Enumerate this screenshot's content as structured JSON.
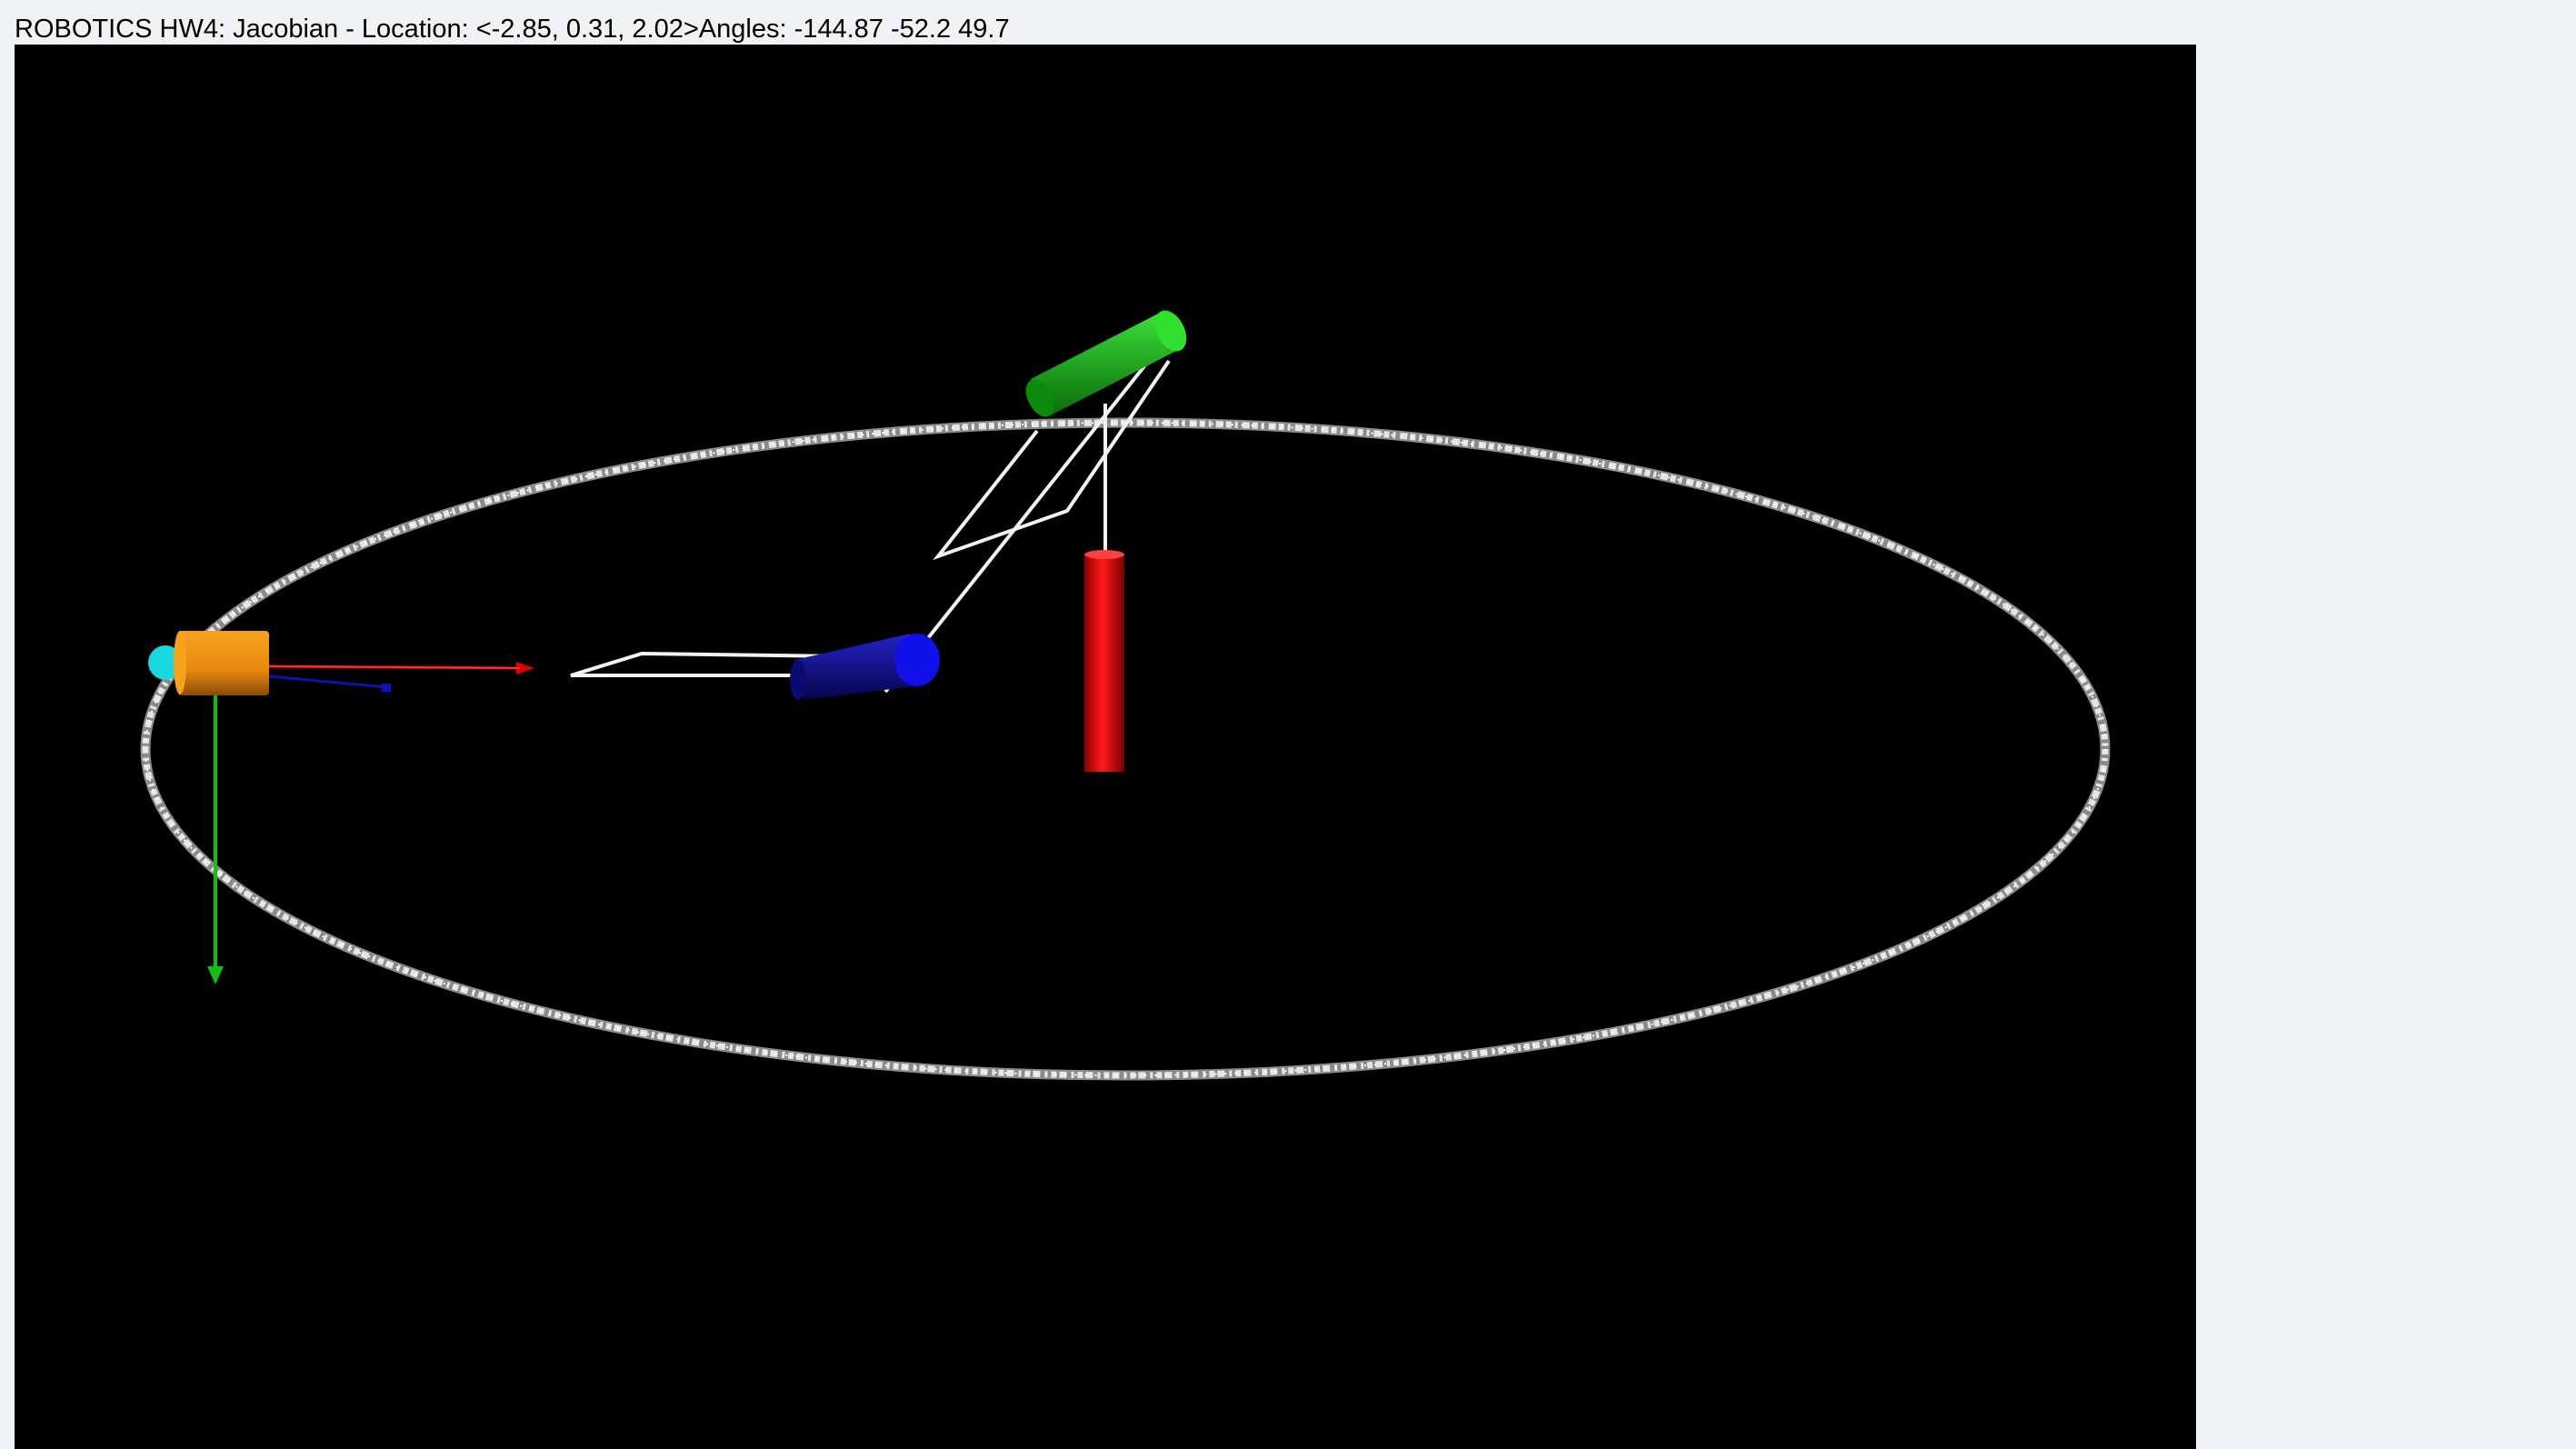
{
  "window": {
    "title_prefix": "ROBOTICS HW4: Jacobian - Location: ",
    "location": "<-2.85, 0.31, 2.02>",
    "angles_label": "Angles: ",
    "angles": "-144.87 -52.2 49.7"
  },
  "scene": {
    "background": "#000000",
    "colors": {
      "trajectory": "#d8d8d8",
      "link": "#ffffff",
      "base_joint": "#e00000",
      "joint_2": "#13c313",
      "joint_3": "#0a0ae0",
      "end_effector": "#f5a21c",
      "end_effector_tip": "#19d8e0",
      "axis_x": "#e00000",
      "axis_y": "#12c012",
      "axis_z": "#1010c0"
    }
  }
}
